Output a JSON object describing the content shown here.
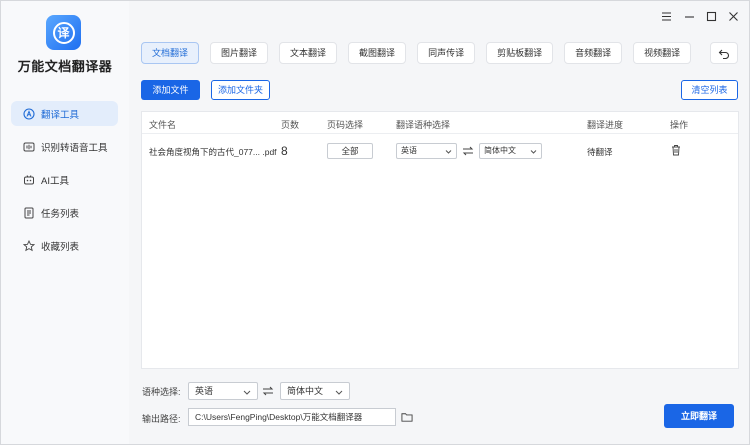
{
  "app": {
    "name": "万能文档翻译器",
    "logo_char": "译"
  },
  "sidebar": {
    "items": [
      {
        "label": "翻译工具",
        "icon": "translate-icon",
        "active": true
      },
      {
        "label": "识别转语音工具",
        "icon": "speech-icon",
        "active": false
      },
      {
        "label": "AI工具",
        "icon": "robot-icon",
        "active": false
      },
      {
        "label": "任务列表",
        "icon": "task-list-icon",
        "active": false
      },
      {
        "label": "收藏列表",
        "icon": "star-icon",
        "active": false
      }
    ]
  },
  "tabs": [
    {
      "label": "文档翻译",
      "active": true
    },
    {
      "label": "图片翻译"
    },
    {
      "label": "文本翻译"
    },
    {
      "label": "截图翻译"
    },
    {
      "label": "同声传译"
    },
    {
      "label": "剪贴板翻译"
    },
    {
      "label": "音频翻译"
    },
    {
      "label": "视频翻译"
    }
  ],
  "toolbar": {
    "add_file": "添加文件",
    "add_folder": "添加文件夹",
    "clear_list": "清空列表"
  },
  "table": {
    "headers": [
      "文件名",
      "页数",
      "页码选择",
      "翻译语种选择",
      "翻译进度",
      "操作"
    ],
    "rows": [
      {
        "filename": "社会角度视角下的古代_077... .pdf",
        "pages": "8",
        "page_select": "全部",
        "source_lang": "英语",
        "target_lang": "简体中文",
        "progress": "待翻译"
      }
    ]
  },
  "bottom": {
    "lang_label": "语种选择:",
    "source_lang": "英语",
    "target_lang": "简体中文",
    "output_label": "输出路径:",
    "output_path": "C:\\Users\\FengPing\\Desktop\\万能文档翻译器",
    "translate_button": "立即翻译"
  },
  "colors": {
    "primary": "#1a66e6",
    "active_bg": "#e3edfb"
  }
}
